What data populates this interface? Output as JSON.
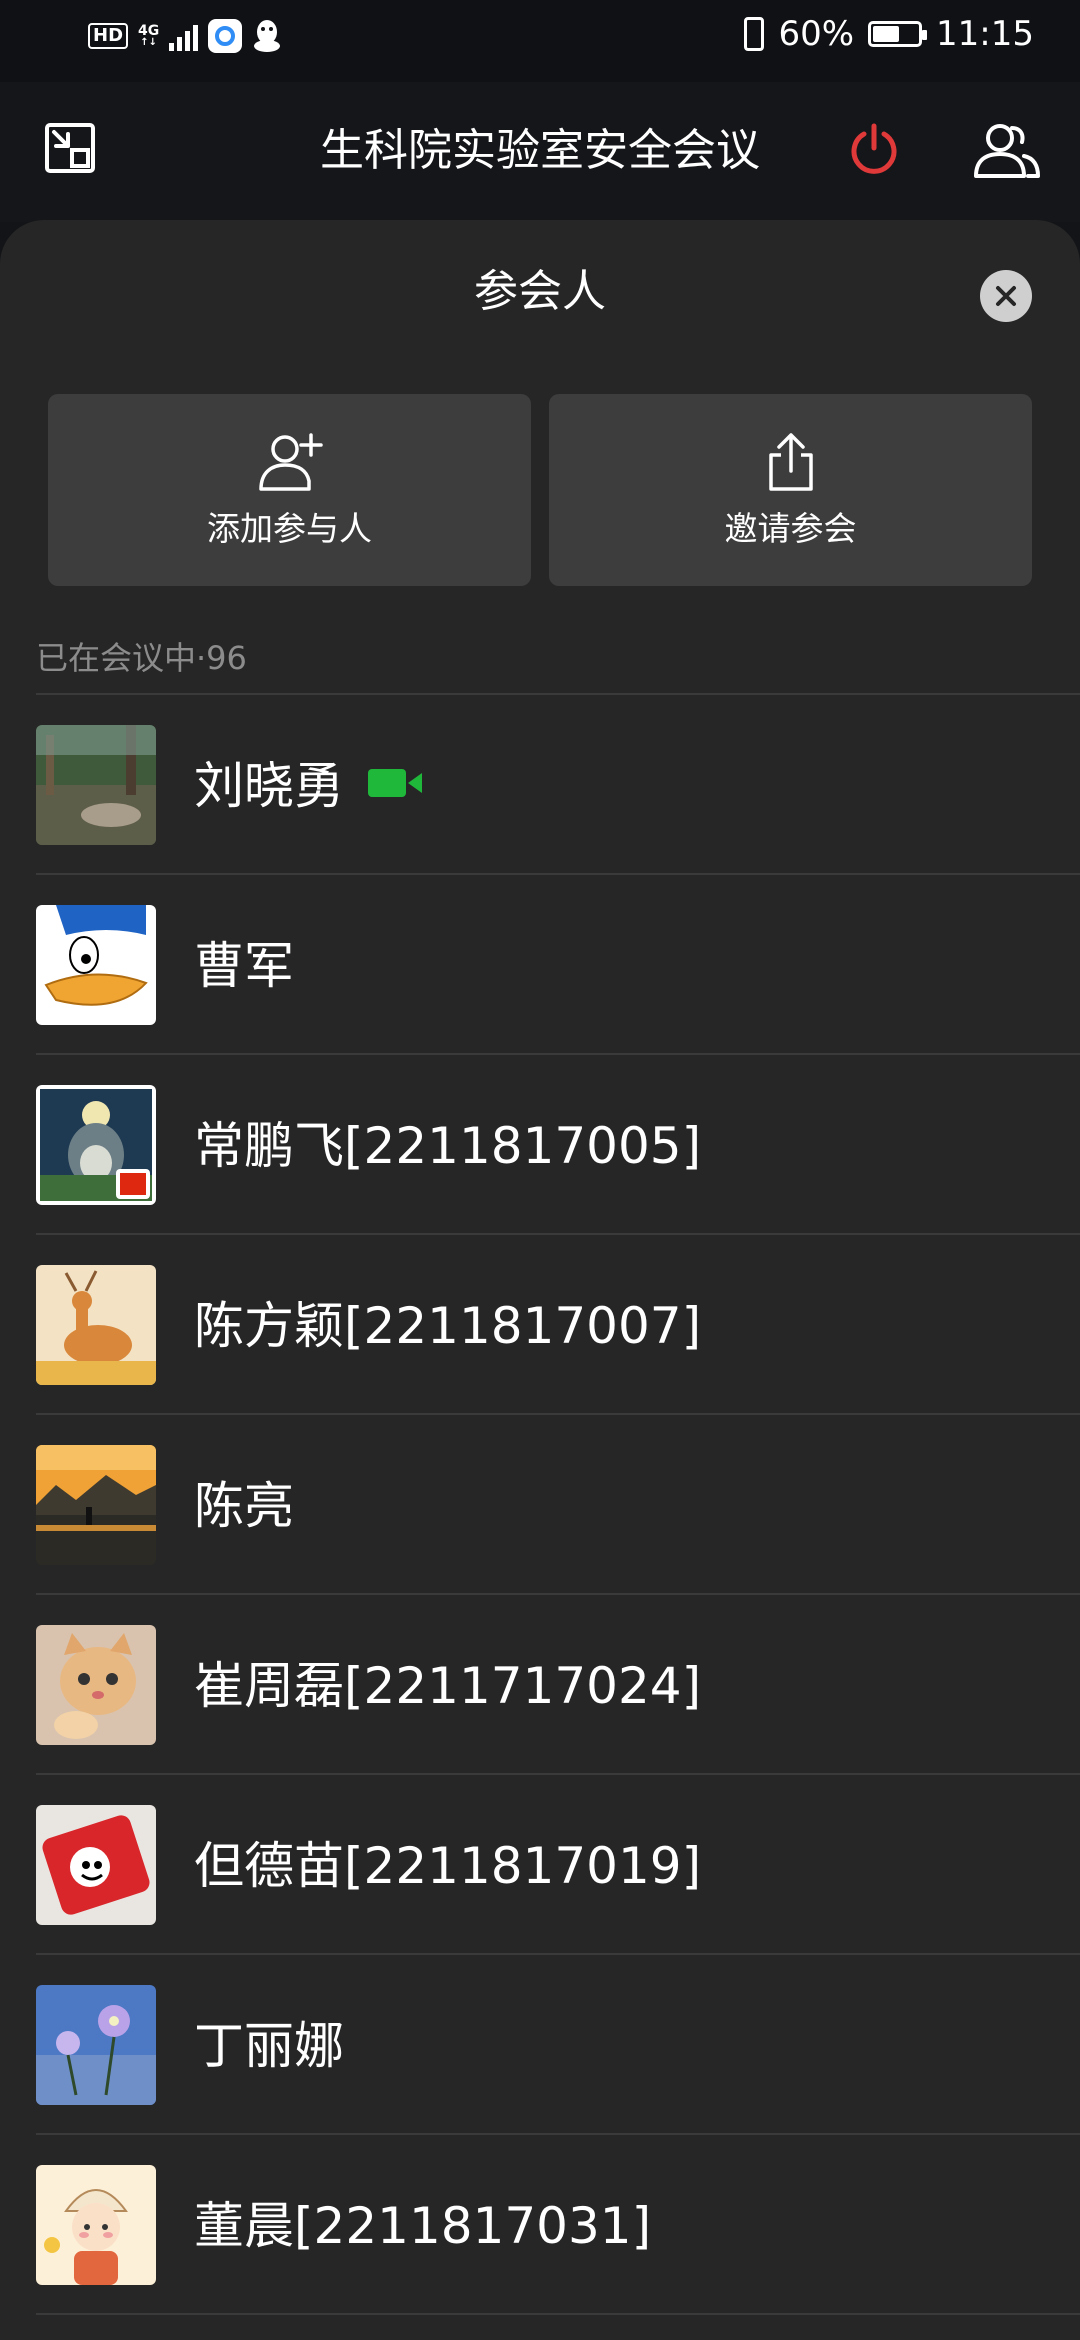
{
  "status_bar": {
    "hd": "HD",
    "network": "4G",
    "battery": "60%",
    "time": "11:15",
    "battery_level": 0.6
  },
  "header": {
    "title": "生科院实验室安全会议",
    "power_color": "#e0393a"
  },
  "panel": {
    "title": "参会人",
    "actions": {
      "add_label": "添加参与人",
      "invite_label": "邀请参会"
    },
    "in_meeting_label": "已在会议中·96"
  },
  "participants": [
    {
      "name": "刘晓勇",
      "video_on": true
    },
    {
      "name": "曹军"
    },
    {
      "name": "常鹏飞[2211817005]"
    },
    {
      "name": "陈方颖[2211817007]"
    },
    {
      "name": "陈亮"
    },
    {
      "name": "崔周磊[2211717024]"
    },
    {
      "name": "但德苗[2211817019]"
    },
    {
      "name": "丁丽娜"
    },
    {
      "name": "董晨[2211817031]"
    }
  ],
  "colors": {
    "accent_green": "#1fb83b",
    "panel_bg": "#262626",
    "button_bg": "#3d3d3d"
  }
}
